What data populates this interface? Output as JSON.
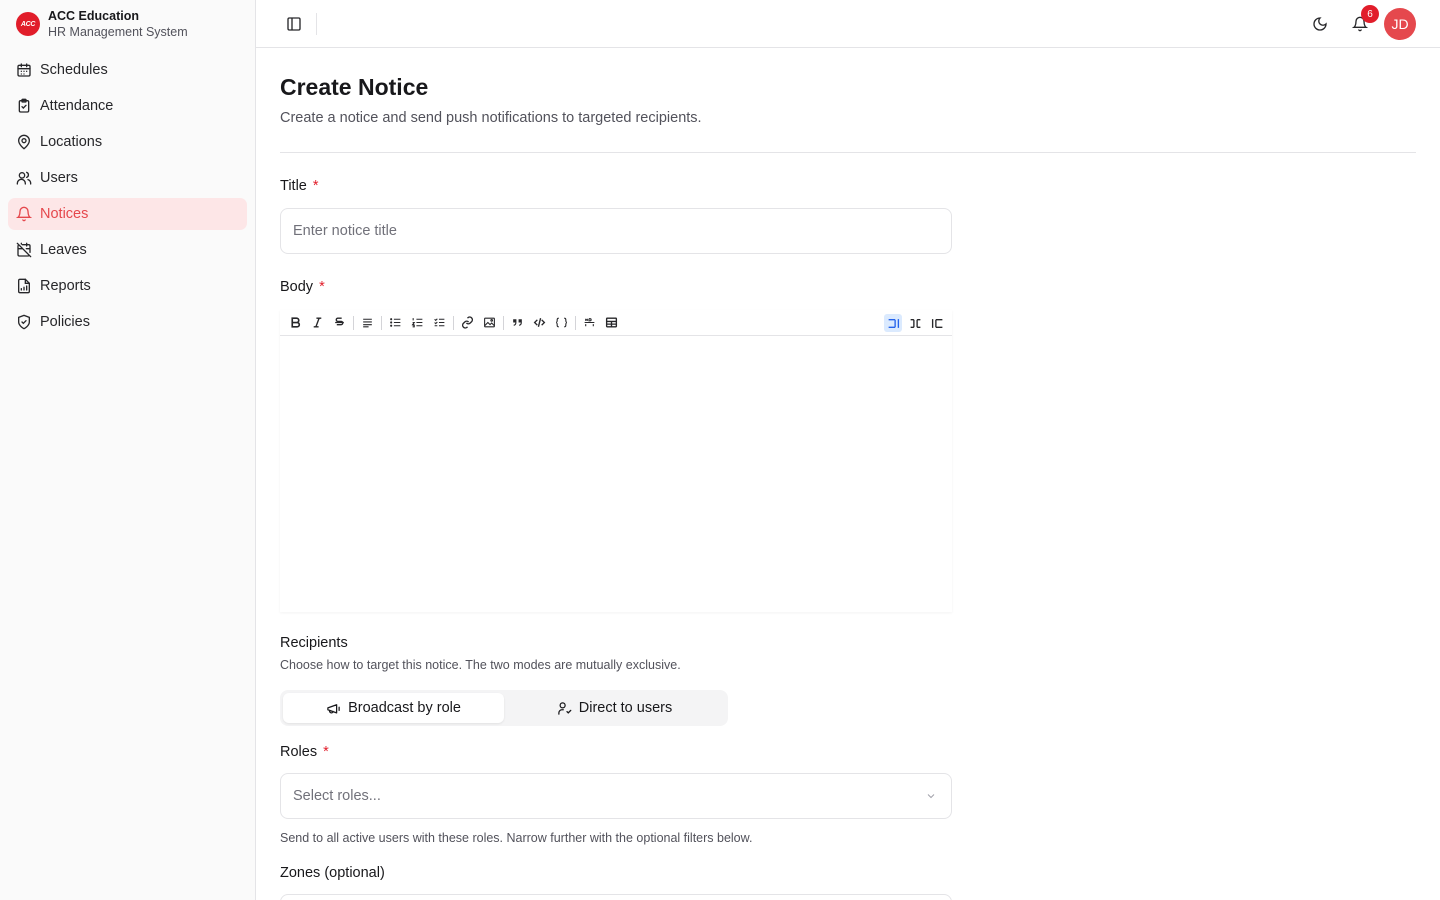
{
  "brand": {
    "name": "ACC Education",
    "subtitle": "HR Management System",
    "logo_text": "ACC"
  },
  "sidebar": {
    "items": [
      {
        "label": "Schedules",
        "icon": "calendar-icon"
      },
      {
        "label": "Attendance",
        "icon": "clipboard-check-icon"
      },
      {
        "label": "Locations",
        "icon": "map-pin-icon"
      },
      {
        "label": "Users",
        "icon": "users-icon"
      },
      {
        "label": "Notices",
        "icon": "bell-icon",
        "active": true
      },
      {
        "label": "Leaves",
        "icon": "calendar-off-icon"
      },
      {
        "label": "Reports",
        "icon": "file-chart-icon"
      },
      {
        "label": "Policies",
        "icon": "shield-check-icon"
      }
    ]
  },
  "topbar": {
    "notification_count": "6",
    "avatar_initials": "JD"
  },
  "page": {
    "title": "Create Notice",
    "description": "Create a notice and send push notifications to targeted recipients."
  },
  "form": {
    "title_label": "Title",
    "title_placeholder": "Enter notice title",
    "body_label": "Body",
    "required_mark": "*",
    "recipients_title": "Recipients",
    "recipients_desc": "Choose how to target this notice. The two modes are mutually exclusive.",
    "mode_broadcast": "Broadcast by role",
    "mode_direct": "Direct to users",
    "roles_label": "Roles",
    "roles_placeholder": "Select roles...",
    "roles_hint": "Send to all active users with these roles. Narrow further with the optional filters below.",
    "zones_label": "Zones (optional)"
  },
  "colors": {
    "accent": "#e5484d",
    "active_bg": "#fde6e7",
    "required": "#e11d2a"
  }
}
